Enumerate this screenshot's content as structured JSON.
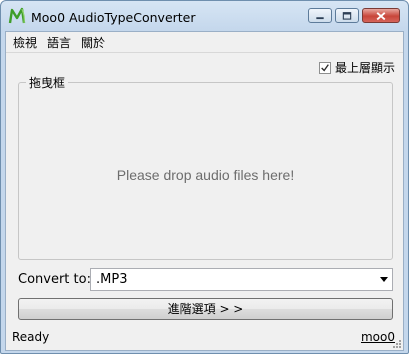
{
  "window": {
    "title": "Moo0 AudioTypeConverter",
    "icon": "moo0-leaf-icon"
  },
  "window_controls": {
    "minimize": "minimize-icon",
    "maximize": "maximize-icon",
    "close": "close-icon"
  },
  "menu": {
    "items": [
      {
        "label": "檢視"
      },
      {
        "label": "語言"
      },
      {
        "label": "關於"
      }
    ]
  },
  "topmost": {
    "label": "最上層顯示",
    "checked": true
  },
  "dropzone": {
    "legend": "拖曳框",
    "hint": "Please drop audio files here!"
  },
  "convert": {
    "label": "Convert to:",
    "selected": ".MP3"
  },
  "advanced_button": {
    "label": "進階選項 > >"
  },
  "status": {
    "text": "Ready",
    "link": "moo0"
  },
  "colors": {
    "titlebar": "#c4d7ec",
    "close_button": "#c8463a",
    "client": "#f0f0f0",
    "hint_text": "#6d6d6d"
  }
}
